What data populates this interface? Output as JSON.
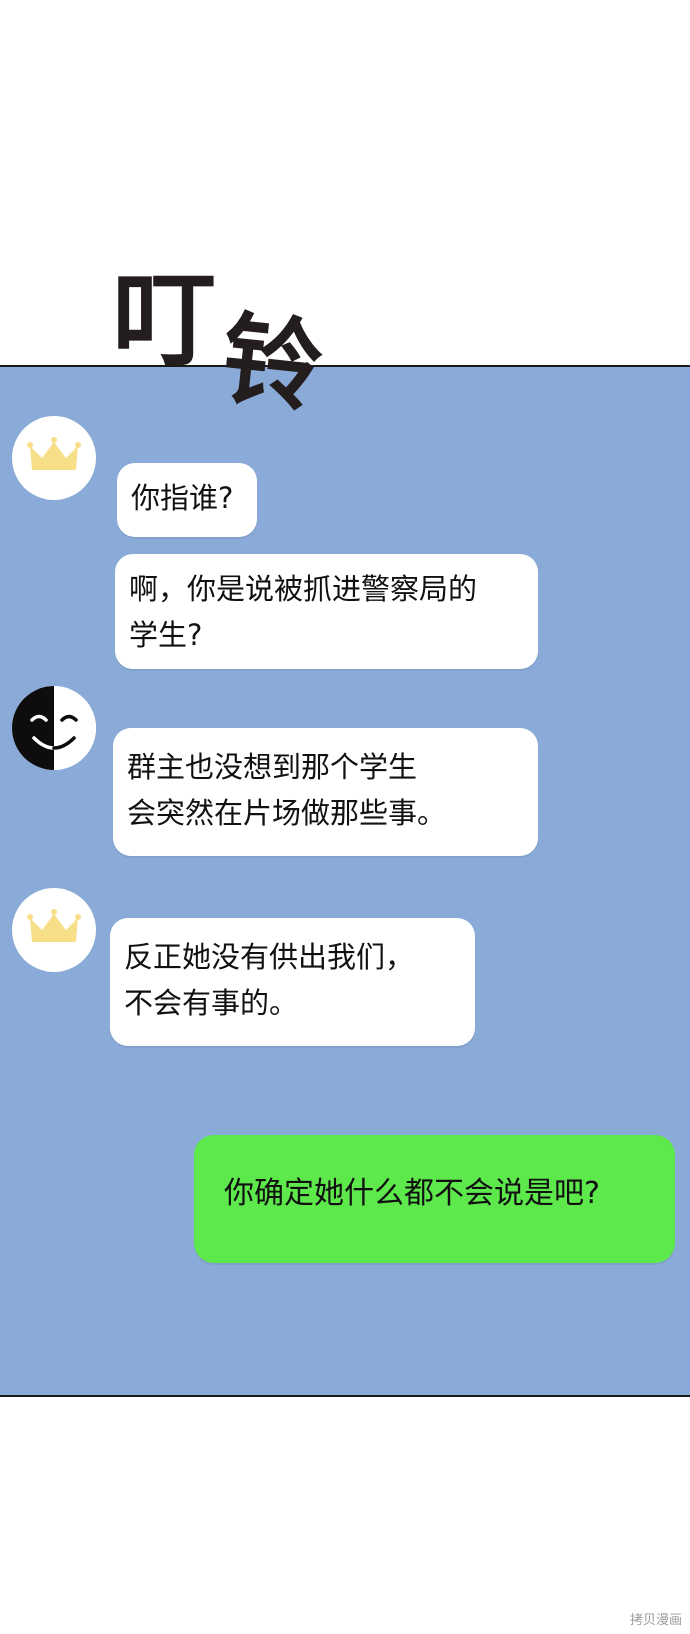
{
  "sound_effect": [
    "叮",
    "铃"
  ],
  "colors": {
    "panel_background": "#8aaad8",
    "incoming_bubble": "#ffffff",
    "outgoing_bubble": "#5de84c",
    "crown": "#f7df8a"
  },
  "messages": [
    {
      "sender_icon": "crown-icon",
      "bubbles": [
        "你指谁?",
        "啊，你是说被抓进警察局的\n学生?"
      ]
    },
    {
      "sender_icon": "smiling-mask-icon",
      "bubbles": [
        "群主也没想到那个学生\n会突然在片场做那些事。"
      ]
    },
    {
      "sender_icon": "crown-icon",
      "bubbles": [
        "反正她没有供出我们，\n不会有事的。"
      ]
    }
  ],
  "outgoing": {
    "text": "你确定她什么都不会说是吧?"
  },
  "watermark": "拷贝漫画"
}
